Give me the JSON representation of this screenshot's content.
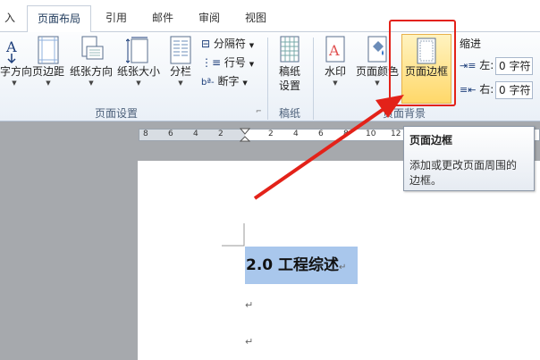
{
  "tabs": [
    {
      "label": "入"
    },
    {
      "label": "页面布局"
    },
    {
      "label": "引用"
    },
    {
      "label": "邮件"
    },
    {
      "label": "审阅"
    },
    {
      "label": "视图"
    }
  ],
  "page_setup": {
    "orientation_partial": "字方向",
    "margins": "页边距",
    "paper_orientation": "纸张方向",
    "paper_size": "纸张大小",
    "columns": "分栏",
    "breaks": "分隔符",
    "line_numbers": "行号",
    "hyphenation": "断字",
    "group_label": "页面设置"
  },
  "draft": {
    "line1": "稿纸",
    "line2": "设置",
    "group_label": "稿纸"
  },
  "page_background": {
    "watermark": "水印",
    "page_color": "页面颜色",
    "page_borders": "页面边框",
    "group_label": "页面背景"
  },
  "paragraph": {
    "indent_label": "缩进",
    "left_label": "左:",
    "left_value": "0 字符",
    "right_label": "右:",
    "right_value": "0 字符"
  },
  "ruler": {
    "ticks": [
      "8",
      "6",
      "4",
      "2",
      "2",
      "4",
      "6",
      "8",
      "10",
      "12"
    ]
  },
  "tooltip": {
    "title": "页面边框",
    "line1": "添加或更改页面周围的",
    "line2": "边框。"
  },
  "document": {
    "heading": "2.0  工程综述",
    "para_mark": "↵"
  },
  "colors": {
    "accent_red": "#e32219",
    "highlight": "#a9c7ec",
    "active_button": "#ffd86a"
  }
}
